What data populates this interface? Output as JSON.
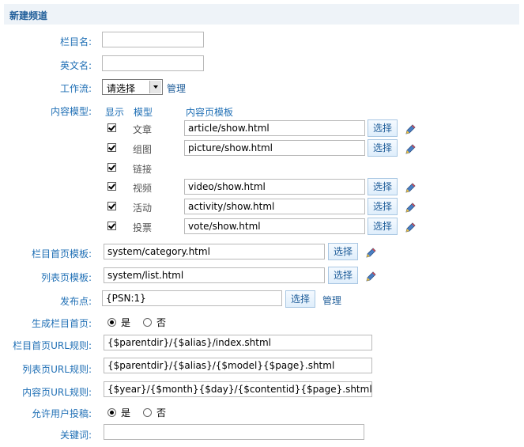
{
  "title": "新建频道",
  "labels": {
    "name": "栏目名:",
    "en_name": "英文名:",
    "workflow": "工作流:",
    "content_model": "内容模型:",
    "category_tpl": "栏目首页模板:",
    "list_tpl": "列表页模板:",
    "publish_point": "发布点:",
    "gen_index": "生成栏目首页:",
    "index_url": "栏目首页URL规则:",
    "list_url": "列表页URL规则:",
    "content_url": "内容页URL规则:",
    "allow_submit": "允许用户投稿:",
    "keywords": "关键词:"
  },
  "fields": {
    "name": "",
    "en_name": "",
    "workflow_selected": "请选择",
    "workflow_manage": "管理",
    "category_tpl": "system/category.html",
    "list_tpl": "system/list.html",
    "publish_point": "{PSN:1}",
    "publish_manage": "管理",
    "index_url": "{$parentdir}/{$alias}/index.shtml",
    "list_url": "{$parentdir}/{$alias}/{$model}{$page}.shtml",
    "content_url": "{$year}/{$month}{$day}/{$contentid}{$page}.shtml",
    "keywords": ""
  },
  "model_table": {
    "col_show": "显示",
    "col_model": "模型",
    "col_tpl": "内容页模板",
    "rows": [
      {
        "model": "文章",
        "checked": true,
        "tpl": "article/show.html"
      },
      {
        "model": "组图",
        "checked": true,
        "tpl": "picture/show.html"
      },
      {
        "model": "链接",
        "checked": true,
        "tpl": null
      },
      {
        "model": "视频",
        "checked": true,
        "tpl": "video/show.html"
      },
      {
        "model": "活动",
        "checked": true,
        "tpl": "activity/show.html"
      },
      {
        "model": "投票",
        "checked": true,
        "tpl": "vote/show.html"
      }
    ]
  },
  "select_label": "选择",
  "yes": "是",
  "no": "否",
  "gen_index_value": "是",
  "allow_submit_value": "是",
  "icons": {
    "edit": "pencil-icon"
  }
}
